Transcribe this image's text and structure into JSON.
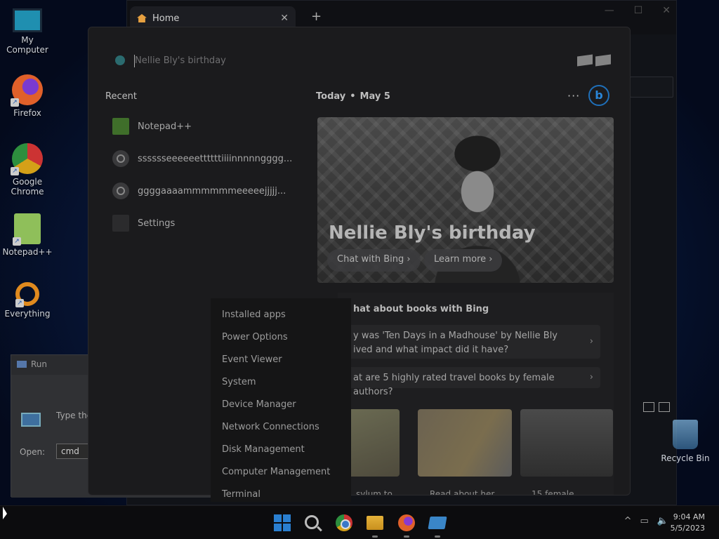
{
  "desktop": {
    "icons": [
      {
        "label": "My Computer",
        "icon": "monitor-icon"
      },
      {
        "label": "Firefox",
        "icon": "firefox-icon"
      },
      {
        "label": "Google Chrome",
        "icon": "chrome-icon"
      },
      {
        "label": "Notepad++",
        "icon": "notepadpp-icon"
      },
      {
        "label": "Everything",
        "icon": "everything-search-icon"
      }
    ],
    "recycle_bin": "Recycle Bin"
  },
  "browser": {
    "tab_title": "Home",
    "close_glyph": "✕",
    "new_tab_glyph": "+"
  },
  "run_dialog": {
    "title": "Run",
    "description": "Type the name of a program, folder, document, or Internet resource",
    "open_label": "Open:",
    "open_value": "cmd"
  },
  "search_flyout": {
    "query": "Nellie Bly's birthday",
    "recent_heading": "Recent",
    "recent": [
      {
        "label": "Notepad++",
        "icon": "notepadpp-icon"
      },
      {
        "label": "sssssseeeeeettttttiiiinnnnngggg...",
        "icon": "search-icon"
      },
      {
        "label": "ggggaaaammmmmmeeeeejjjjj...",
        "icon": "search-icon"
      },
      {
        "label": "Settings",
        "icon": "settings-icon"
      }
    ],
    "today_label": "Today",
    "date_label": "May 5",
    "more_glyph": "···",
    "bing_glyph": "b",
    "hero": {
      "title": "Nellie Bly's birthday",
      "chat_button": "Chat with Bing",
      "learn_button": "Learn more",
      "chevron": "›"
    },
    "books": {
      "heading": "hat about books with Bing",
      "questions": [
        {
          "line1": "y was 'Ten Days in a Madhouse' by Nellie Bly",
          "line2": "ived and what impact did it have?"
        },
        {
          "line1": "at are 5 highly rated travel books by female authors?",
          "line2": ""
        }
      ],
      "captions": [
        "sylum to",
        "Read about her",
        "15 female"
      ]
    }
  },
  "context_menu": [
    "Installed apps",
    "Power Options",
    "Event Viewer",
    "System",
    "Device Manager",
    "Network Connections",
    "Disk Management",
    "Computer Management",
    "Terminal"
  ],
  "taskbar": {
    "time": "9:04 AM",
    "date": "5/5/2023",
    "tray_chevron": "^"
  }
}
